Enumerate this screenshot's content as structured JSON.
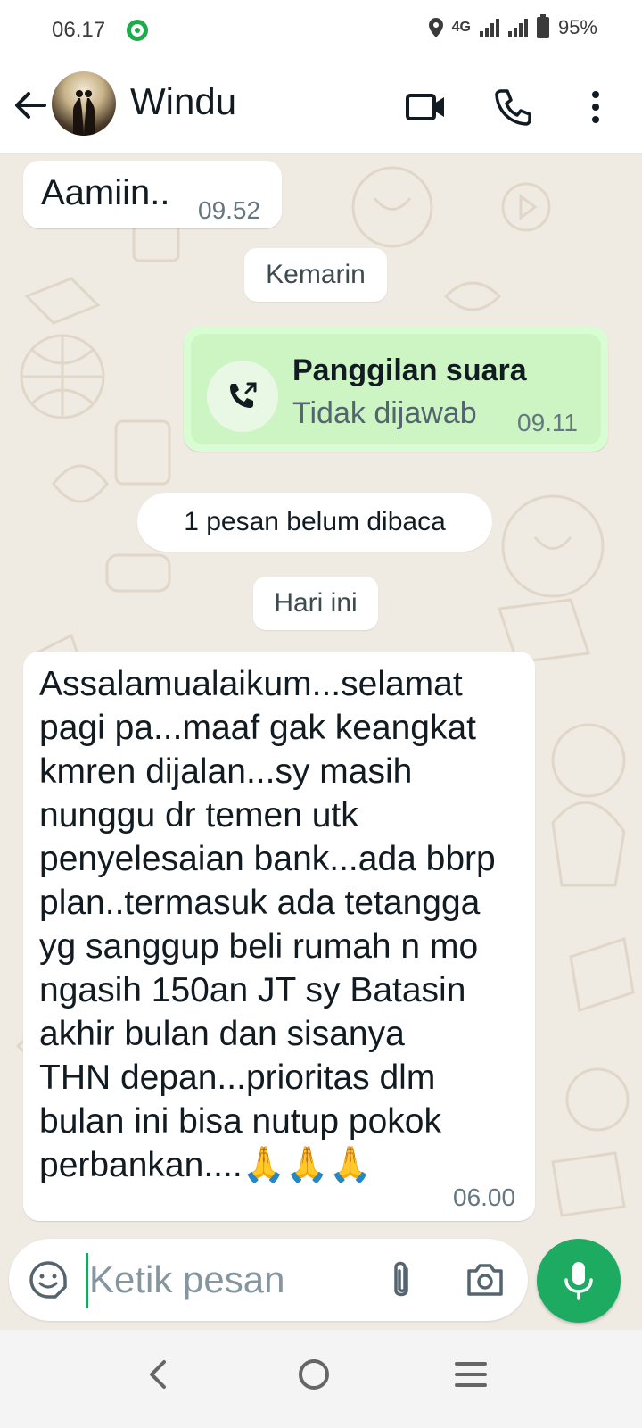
{
  "status_bar": {
    "time": "06.17",
    "network": "4G",
    "battery": "95%"
  },
  "header": {
    "contact_name": "Windu"
  },
  "messages": [
    {
      "direction": "incoming",
      "text": "Aamiin..",
      "time": "09.52"
    },
    {
      "type": "date_chip",
      "text": "Kemarin"
    },
    {
      "direction": "outgoing",
      "type": "call",
      "title": "Panggilan suara",
      "status": "Tidak dijawab",
      "time": "09.11"
    },
    {
      "type": "unread_chip",
      "text": "1 pesan belum dibaca"
    },
    {
      "type": "date_chip",
      "text": "Hari ini"
    },
    {
      "direction": "incoming",
      "text": "Assalamualaikum...selamat\npagi pa...maaf gak keangkat\nkmren dijalan...sy masih\nnunggu dr temen utk\npenyelesaian bank...ada bbrp\nplan..termasuk ada tetangga\nyg sanggup beli rumah n mo\nngasih 150an JT sy Batasin\nakhir bulan dan sisanya\nTHN depan...prioritas dlm\nbulan ini bisa nutup pokok\nperbankan....🙏🙏🙏",
      "time": "06.00"
    }
  ],
  "input": {
    "placeholder": "Ketik pesan"
  },
  "colors": {
    "accent": "#1daa61",
    "outgoing_bubble": "#d9fdd3",
    "chat_background": "#efeae2"
  },
  "icons": [
    "back-arrow-icon",
    "video-call-icon",
    "phone-icon",
    "more-vert-icon",
    "missed-call-icon",
    "emoji-icon",
    "attachment-icon",
    "camera-icon",
    "mic-icon"
  ]
}
